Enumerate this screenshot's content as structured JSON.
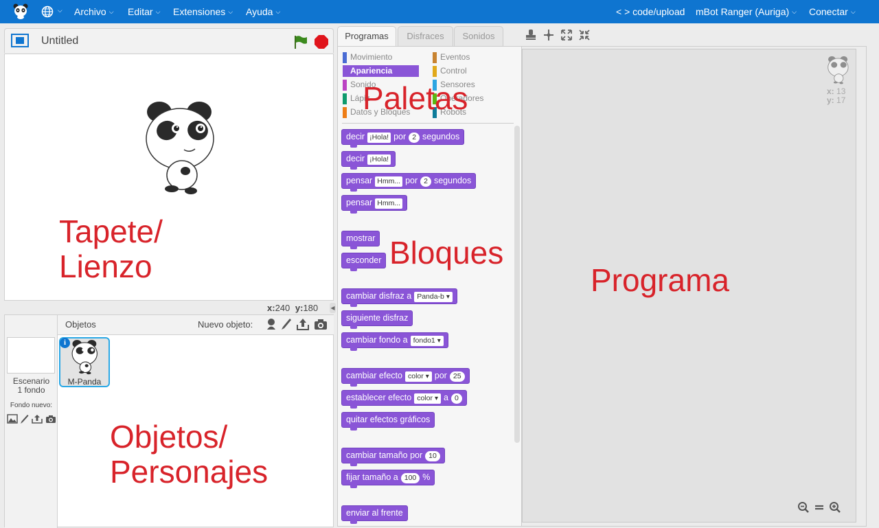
{
  "menu": {
    "items": [
      "Archivo",
      "Editar",
      "Extensiones",
      "Ayuda"
    ],
    "code_upload": "< > code/upload",
    "board": "mBot Ranger (Auriga)",
    "connect": "Conectar"
  },
  "stage": {
    "title": "Untitled",
    "x_label": "x:",
    "x_value": "240",
    "y_label": "y:",
    "y_value": "180"
  },
  "sprites": {
    "header": "Objetos",
    "new_object": "Nuevo objeto:",
    "stage_label": "Escenario",
    "stage_backdrops": "1 fondo",
    "new_backdrop": "Fondo nuevo:",
    "sprite_name": "M-Panda"
  },
  "tabs": [
    "Programas",
    "Disfraces",
    "Sonidos"
  ],
  "categories_left": [
    {
      "label": "Movimiento",
      "color": "#4a6cd4"
    },
    {
      "label": "Apariencia",
      "color": "#8a55d7",
      "selected": true
    },
    {
      "label": "Sonido",
      "color": "#bb42c3"
    },
    {
      "label": "Lápiz",
      "color": "#0e9a6c"
    },
    {
      "label": "Datos y Bloques",
      "color": "#ee7d16"
    }
  ],
  "categories_right": [
    {
      "label": "Eventos",
      "color": "#c88330"
    },
    {
      "label": "Control",
      "color": "#e1a91a"
    },
    {
      "label": "Sensores",
      "color": "#2ca5e2"
    },
    {
      "label": "Operadores",
      "color": "#5cb712"
    },
    {
      "label": "Robots",
      "color": "#0e7c9a"
    }
  ],
  "blocks": {
    "b1": {
      "t1": "decir",
      "i1": "¡Hola!",
      "t2": "por",
      "n1": "2",
      "t3": "segundos"
    },
    "b2": {
      "t1": "decir",
      "i1": "¡Hola!"
    },
    "b3": {
      "t1": "pensar",
      "i1": "Hmm...",
      "t2": "por",
      "n1": "2",
      "t3": "segundos"
    },
    "b4": {
      "t1": "pensar",
      "i1": "Hmm..."
    },
    "b5": {
      "t1": "mostrar"
    },
    "b6": {
      "t1": "esconder"
    },
    "b7": {
      "t1": "cambiar disfraz a",
      "d1": "Panda-b"
    },
    "b8": {
      "t1": "siguiente disfraz"
    },
    "b9": {
      "t1": "cambiar fondo a",
      "d1": "fondo1"
    },
    "b10": {
      "t1": "cambiar efecto",
      "d1": "color",
      "t2": "por",
      "n1": "25"
    },
    "b11": {
      "t1": "establecer efecto",
      "d1": "color",
      "t2": "a",
      "n1": "0"
    },
    "b12": {
      "t1": "quitar efectos gráficos"
    },
    "b13": {
      "t1": "cambiar tamaño por",
      "n1": "10"
    },
    "b14": {
      "t1": "fijar tamaño a",
      "n1": "100",
      "t2": "%"
    },
    "b15": {
      "t1": "enviar al frente"
    }
  },
  "script": {
    "x_label": "x:",
    "x_value": "13",
    "y_label": "y:",
    "y_value": "17"
  },
  "annotations": {
    "paletas": "Paletas",
    "bloques": "Bloques",
    "programa": "Programa",
    "tapete_1": "Tapete/",
    "tapete_2": "Lienzo",
    "objetos_1": "Objetos/",
    "objetos_2": "Personajes"
  },
  "colors": {
    "topbar": "#0f75d0",
    "looks_block": "#8a55d7",
    "annotation": "#d8232a"
  }
}
